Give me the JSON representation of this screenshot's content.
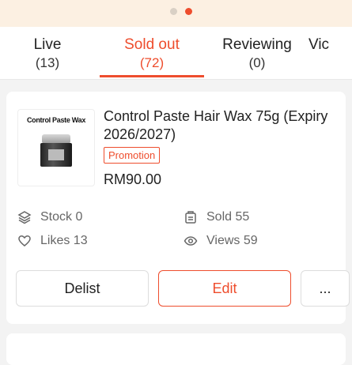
{
  "tabs": [
    {
      "label": "Live",
      "count": "(13)"
    },
    {
      "label": "Sold out",
      "count": "(72)"
    },
    {
      "label": "Reviewing",
      "count": "(0)"
    },
    {
      "label": "Vic",
      "count": ""
    }
  ],
  "active_tab": "Sold out",
  "product": {
    "thumb_text": "Control Paste Wax",
    "title": "Control Paste Hair Wax 75g (Expiry 2026/2027)",
    "promo_badge": "Promotion",
    "price": "RM90.00",
    "stats": {
      "stock": "Stock 0",
      "sold": "Sold 55",
      "likes": "Likes 13",
      "views": "Views 59"
    },
    "actions": {
      "delist": "Delist",
      "edit": "Edit",
      "more": "..."
    }
  },
  "colors": {
    "accent": "#ee4d2d",
    "banner_bg": "#fcf0e2",
    "page_bg": "#f3f3f3"
  },
  "icons": [
    "layers-icon",
    "receipt-icon",
    "heart-icon",
    "eye-icon"
  ]
}
